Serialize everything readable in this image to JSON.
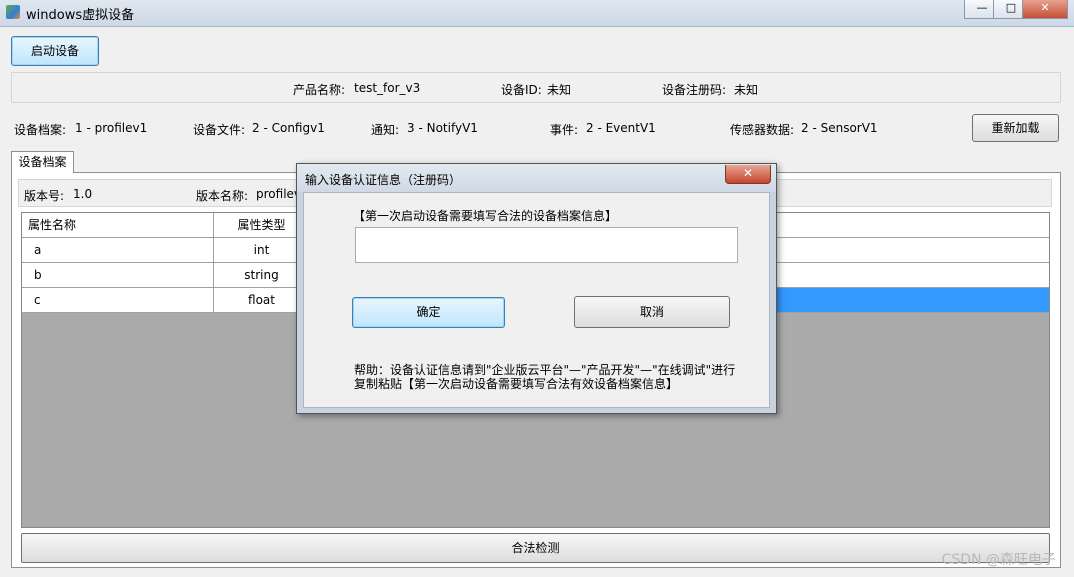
{
  "window": {
    "title": "windows虚拟设备",
    "minimize": "—",
    "maximize": "□",
    "close": "✕"
  },
  "toolbar": {
    "start_label": "启动设备"
  },
  "info": {
    "product_name_label": "产品名称:",
    "product_name_value": "test_for_v3",
    "device_id_label": "设备ID:",
    "device_id_value": "未知",
    "reg_code_label": "设备注册码:",
    "reg_code_value": "未知"
  },
  "files": {
    "profile_label": "设备档案:",
    "profile_value": "1 - profilev1",
    "config_label": "设备文件:",
    "config_value": "2 - Configv1",
    "notify_label": "通知:",
    "notify_value": "3 - NotifyV1",
    "event_label": "事件:",
    "event_value": "2 - EventV1",
    "sensor_label": "传感器数据:",
    "sensor_value": "2 - SensorV1",
    "reload_label": "重新加载"
  },
  "tab": {
    "label": "设备档案"
  },
  "version": {
    "num_label": "版本号:",
    "num_value": "1.0",
    "name_label": "版本名称:",
    "name_value": "profilev1"
  },
  "grid": {
    "headers": [
      "属性名称",
      "属性类型"
    ],
    "rows": [
      [
        "a",
        "int"
      ],
      [
        "b",
        "string"
      ],
      [
        "c",
        "float"
      ]
    ]
  },
  "validate_label": "合法检测",
  "dialog": {
    "title": "输入设备认证信息（注册码）",
    "close": "✕",
    "prompt": "【第一次启动设备需要填写合法的设备档案信息】",
    "input_value": "",
    "ok_label": "确定",
    "cancel_label": "取消",
    "help_line1": "帮助：设备认证信息请到\"企业版云平台\"—\"产品开发\"—\"在线调试\"进行",
    "help_line2": "复制粘贴【第一次启动设备需要填写合法有效设备档案信息】"
  },
  "watermark": "CSDN @森旺电子",
  "colors": {
    "selected_row": "#3399ff",
    "grid_background": "#aaaaaa",
    "dialog_frame": "#c9d3df"
  }
}
